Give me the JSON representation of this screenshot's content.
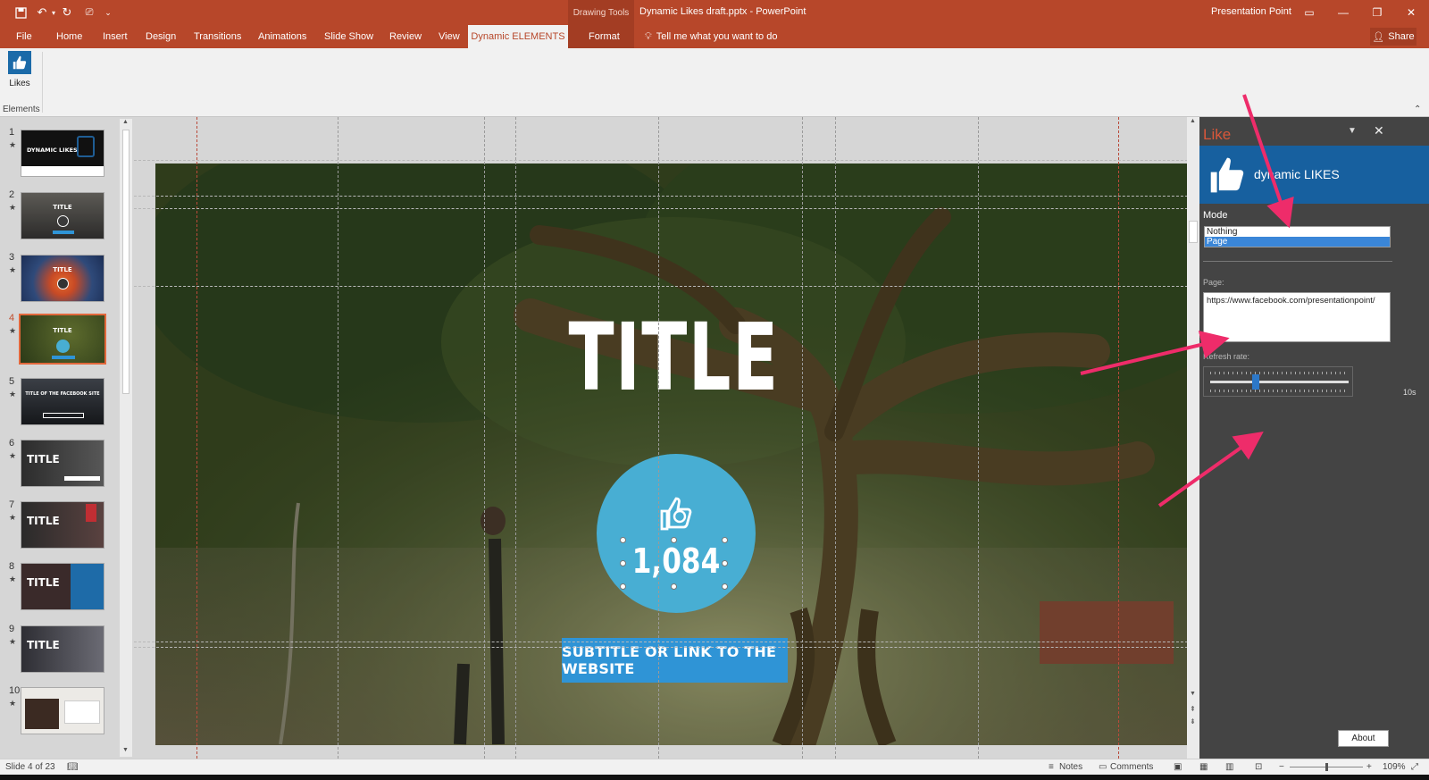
{
  "window": {
    "drawing_tools": "Drawing Tools",
    "doc_title": "Dynamic Likes draft.pptx - PowerPoint",
    "account": "Presentation Point"
  },
  "tabs": [
    "File",
    "Home",
    "Insert",
    "Design",
    "Transitions",
    "Animations",
    "Slide Show",
    "Review",
    "View",
    "Dynamic ELEMENTS",
    "Format"
  ],
  "tell_me": "Tell me what you want to do",
  "share": "Share",
  "ribbon": {
    "likes": "Likes",
    "group": "Elements"
  },
  "thumbnails": [
    {
      "num": "1",
      "text": "DYNAMIC LIKES"
    },
    {
      "num": "2",
      "text": "TITLE"
    },
    {
      "num": "3",
      "text": "TITLE"
    },
    {
      "num": "4",
      "text": "TITLE"
    },
    {
      "num": "5",
      "text": "TITLE OF THE FACEBOOK SITE"
    },
    {
      "num": "6",
      "text": "TITLE"
    },
    {
      "num": "7",
      "text": "TITLE"
    },
    {
      "num": "8",
      "text": "TITLE"
    },
    {
      "num": "9",
      "text": "TITLE"
    },
    {
      "num": "10",
      "text": ""
    }
  ],
  "slide": {
    "title": "TITLE",
    "likes_count": "1,084",
    "subtitle": "SUBTITLE OR LINK TO THE WEBSITE"
  },
  "pane": {
    "title": "Like",
    "banner": "dynamic LIKES",
    "mode_label": "Mode",
    "mode_options": [
      "Nothing",
      "Page"
    ],
    "mode_selected": "Page",
    "page_label": "Page:",
    "page_value": "https://www.facebook.com/presentationpoint/",
    "refresh_label": "Refresh rate:",
    "refresh_value": "10s",
    "refresh_fraction": 0.33,
    "about": "About"
  },
  "status": {
    "slide_info": "Slide 4 of 23",
    "notes": "Notes",
    "comments": "Comments",
    "zoom": "109%"
  },
  "colors": {
    "brand": "#b7472a",
    "like_circle": "#48aed3",
    "subtitle_bg": "#2f94d6",
    "banner": "#17609f",
    "annotation_arrow": "#ee2c6a"
  }
}
